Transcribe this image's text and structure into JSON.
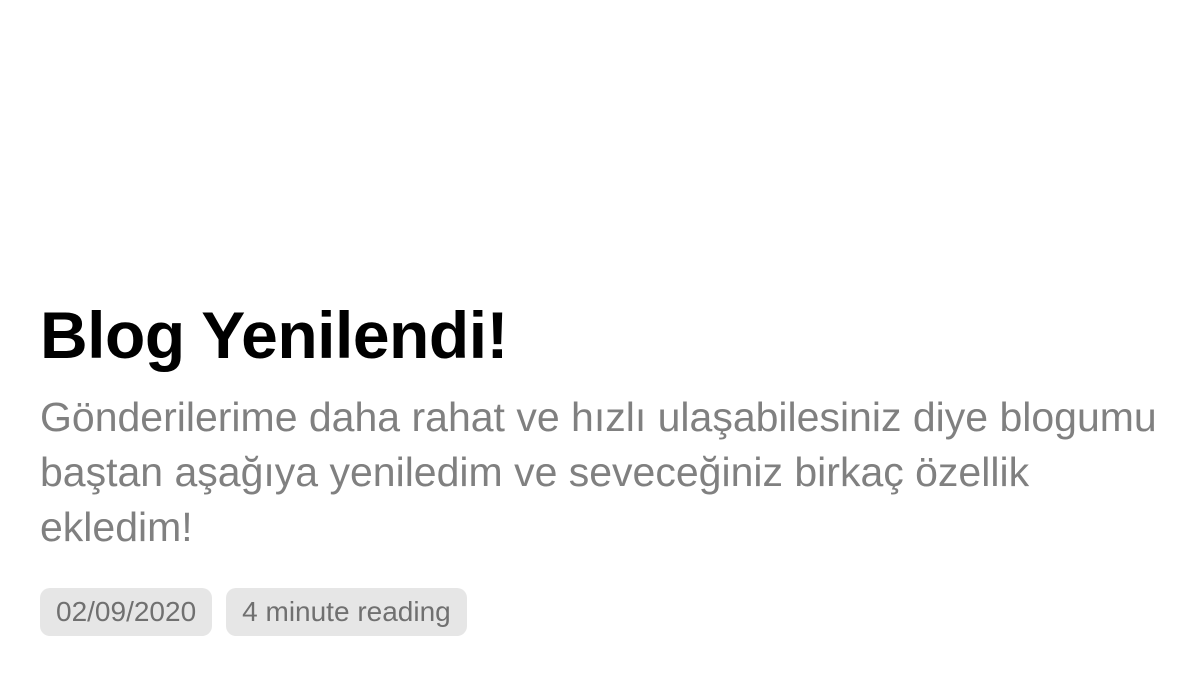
{
  "post": {
    "title": "Blog Yenilendi!",
    "description": "Gönderilerime daha rahat ve hızlı ulaşabilesiniz diye blogumu baştan aşağıya yeniledim ve seveceğiniz birkaç özellik ekledim!",
    "date": "02/09/2020",
    "reading_time": "4 minute reading"
  },
  "colors": {
    "background": "#ffffff",
    "title": "#000000",
    "description": "#808080",
    "badge_background": "#e6e6e6",
    "badge_text": "#707070"
  }
}
